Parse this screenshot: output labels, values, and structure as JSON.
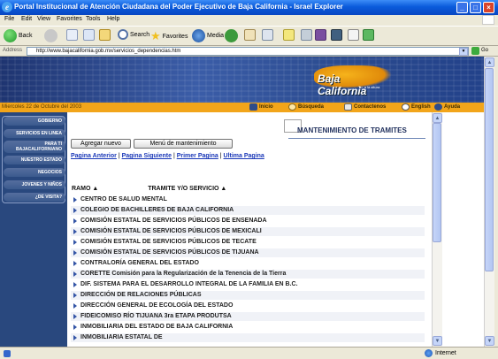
{
  "window": {
    "title": "Portal Institucional de Atención Ciudadana del Poder Ejecutivo de Baja California - Israel Explorer"
  },
  "menu": [
    "File",
    "Edit",
    "View",
    "Favorites",
    "Tools",
    "Help"
  ],
  "toolbar": {
    "back": "Back",
    "search": "Search",
    "favorites": "Favorites",
    "media": "Media"
  },
  "address": {
    "label": "Address",
    "url": "http://www.bajacalifornia.gob.mx/servicios_dependencias.htm",
    "go": "Go"
  },
  "banner": {
    "logo_text": "Baja California",
    "logo_sub": "Tu, a la altura"
  },
  "infobar": {
    "date": "Miercoles 22 de Octubre del 2003",
    "inicio": "Inicio",
    "busqueda": "Búsqueda",
    "contactenos": "Contactenos",
    "english": "English",
    "ayuda": "Ayuda"
  },
  "sidebar": [
    "GOBIERNO",
    "SERVICIOS EN LINEA",
    "PARA TI BAJACALIFORNIANO",
    "NUESTRO ESTADO",
    "NEGOCIOS",
    "JOVENES Y NIÑOS",
    "¿DE VISITA?"
  ],
  "page": {
    "title": "MANTENIMIENTO DE TRAMITES",
    "btn_add": "Agregar nuevo",
    "btn_menu": "Menú de mantenimiento",
    "nav": {
      "prev": "Pagina Anterior",
      "next": "Pagina Siguiente",
      "first": "Primer Pagina",
      "last": "Ultima Pagina",
      "sep": " | "
    },
    "col_ramo": "RAMO ▲",
    "col_tramite": "TRAMITE Y/O SERVICIO ▲",
    "rows": [
      "CENTRO DE SALUD MENTAL",
      "COLEGIO DE BACHILLERES DE BAJA CALIFORNIA",
      "COMISIÓN ESTATAL DE SERVICIOS PÚBLICOS DE ENSENADA",
      "COMISIÓN ESTATAL DE SERVICIOS PÚBLICOS DE MEXICALI",
      "COMISIÓN ESTATAL DE SERVICIOS PÚBLICOS DE TECATE",
      "COMISIÓN ESTATAL DE SERVICIOS PÚBLICOS DE TIJUANA",
      "CONTRALORÍA GENERAL DEL ESTADO",
      "CORETTE Comisión para la Regularización de la Tenencia de la Tierra",
      "DIF. SISTEMA PARA EL DESARROLLO INTEGRAL DE LA FAMILIA EN B.C.",
      "DIRECCIÓN DE RELACIONES PÚBLICAS",
      "DIRECCIÓN GENERAL DE ECOLOGÍA DEL ESTADO",
      "FIDEICOMISO RÍO TIJUANA 3ra ETAPA PRODUTSA",
      "INMOBILIARIA DEL ESTADO DE BAJA CALIFORNIA",
      "INMOBILIARIA ESTATAL DE"
    ]
  },
  "status": {
    "zone": "Internet"
  }
}
